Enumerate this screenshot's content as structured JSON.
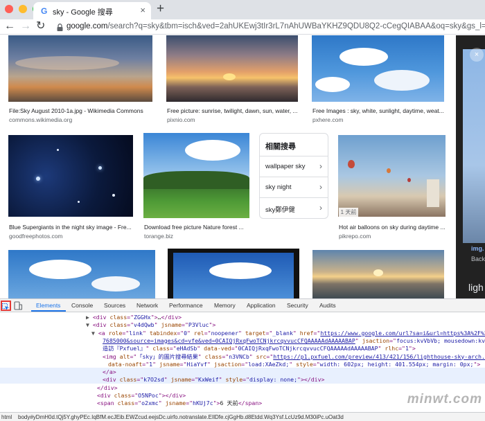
{
  "browser": {
    "tab_title": "sky - Google 搜尋",
    "tab_favicon": "G",
    "close_glyph": "×",
    "newtab_glyph": "+",
    "back_glyph": "←",
    "forward_glyph": "→",
    "reload_glyph": "↻",
    "url_host": "google.com",
    "url_path": "/search?q=sky&tbm=isch&ved=2ahUKEwj3tIr3rL7nAhUWBaYKHZ9QDU8Q2-cCegQIABAA&oq=sky&gs_l=img.3..0l10.3..."
  },
  "results": {
    "row1": [
      {
        "caption": "File:Sky August 2010-1a.jpg - Wikimedia Commons",
        "source": "commons.wikimedia.org"
      },
      {
        "caption": "Free picture: sunrise, twilight, dawn, sun, water, ...",
        "source": "pixnio.com"
      },
      {
        "caption": "Free Images : sky, white, sunlight, daytime, weat...",
        "source": "pxhere.com"
      }
    ],
    "row2": [
      {
        "caption": "Blue Supergiants in the night sky image - Fre...",
        "source": "goodfreephotos.com"
      },
      {
        "caption": "Download free picture Nature forest ...",
        "source": "torange.biz"
      },
      {
        "caption": "Hot air balloons on sky during daytime ...",
        "source": "pikrepo.com",
        "badge": "1 天前"
      }
    ]
  },
  "related": {
    "title": "相關搜尋",
    "chevron": "›",
    "items": [
      "wallpaper sky",
      "sky night",
      "sky鄭伊健"
    ]
  },
  "side_panel": {
    "close_glyph": "×",
    "snippet1": "img.",
    "snippet2": "Back",
    "snippet3": "ligh"
  },
  "devtools": {
    "tabs": [
      "Elements",
      "Console",
      "Sources",
      "Network",
      "Performance",
      "Memory",
      "Application",
      "Security",
      "Audits"
    ],
    "active_tab": "Elements",
    "breadcrumb_html": "html",
    "breadcrumb_body": "body#yDmH0d.tQj5Y.ghyPEc.IqBfM.ecJEib.EWZcud.eejsDc.uirfo.notranslate.EIlDfe.cjGgHb.d8Etdd.Wq3Ysf.LcUz9d.M30iPc.uOat3d",
    "code_lines": [
      {
        "indent": 16,
        "tri": "▶",
        "parts": [
          [
            "tag",
            "<div "
          ],
          [
            "attr",
            "class"
          ],
          [
            "tag",
            "=\""
          ],
          [
            "val",
            "ZGGHx"
          ],
          [
            "tag",
            "\">"
          ],
          [
            "txt",
            "…"
          ],
          [
            "tag",
            "</div>"
          ]
        ]
      },
      {
        "indent": 16,
        "tri": "▼",
        "parts": [
          [
            "tag",
            "<div "
          ],
          [
            "attr",
            "class"
          ],
          [
            "tag",
            "=\""
          ],
          [
            "val",
            "v4dQwb"
          ],
          [
            "tag",
            "\" "
          ],
          [
            "attr",
            "jsname"
          ],
          [
            "tag",
            "=\""
          ],
          [
            "val",
            "P3Vluc"
          ],
          [
            "tag",
            "\">"
          ]
        ]
      },
      {
        "indent": 24,
        "tri": "▼",
        "parts": [
          [
            "tag",
            "<a "
          ],
          [
            "attr",
            "role"
          ],
          [
            "tag",
            "=\""
          ],
          [
            "val",
            "link"
          ],
          [
            "tag",
            "\" "
          ],
          [
            "attr",
            "tabindex"
          ],
          [
            "tag",
            "=\""
          ],
          [
            "val",
            "0"
          ],
          [
            "tag",
            "\" "
          ],
          [
            "attr",
            "rel"
          ],
          [
            "tag",
            "=\""
          ],
          [
            "val",
            "noopener"
          ],
          [
            "tag",
            "\" "
          ],
          [
            "attr",
            "target"
          ],
          [
            "tag",
            "=\""
          ],
          [
            "val",
            "_blank"
          ],
          [
            "tag",
            "\" "
          ],
          [
            "attr",
            "href"
          ],
          [
            "tag",
            "=\""
          ],
          [
            "link",
            "https://www.google.com/url?sa=i&url=https%3A%2F%2F..."
          ]
        ]
      },
      {
        "indent": 40,
        "tri": "",
        "parts": [
          [
            "link",
            "7685000&source=images&cd=vfe&ved=0CAIQjRxqFwoTCNjkrcqvvucCFQAAAAAdAAAAABAP"
          ],
          [
            "tag",
            "\" "
          ],
          [
            "attr",
            "jsaction"
          ],
          [
            "tag",
            "=\""
          ],
          [
            "val",
            "focus:kvVbVb; mousedown:kvVbVb"
          ]
        ]
      },
      {
        "indent": 40,
        "tri": "",
        "parts": [
          [
            "val",
            "造訪『Pxfuel』"
          ],
          [
            "tag",
            "\" "
          ],
          [
            "attr",
            "class"
          ],
          [
            "tag",
            "=\""
          ],
          [
            "val",
            "eHAdSb"
          ],
          [
            "tag",
            "\" "
          ],
          [
            "attr",
            "data-ved"
          ],
          [
            "tag",
            "=\""
          ],
          [
            "val",
            "0CAIQjRxqFwoTCNjkrcqvvucCFQAAAAAdAAAAABAP"
          ],
          [
            "tag",
            "\" "
          ],
          [
            "attr",
            "rlhc"
          ],
          [
            "tag",
            "=\""
          ],
          [
            "val",
            "1"
          ],
          [
            "tag",
            "\">"
          ]
        ]
      },
      {
        "indent": 40,
        "tri": "",
        "parts": [
          [
            "tag",
            "<img "
          ],
          [
            "attr",
            "alt"
          ],
          [
            "tag",
            "=\""
          ],
          [
            "val",
            "「sky」的圖片搜尋結果"
          ],
          [
            "tag",
            "\" "
          ],
          [
            "attr",
            "class"
          ],
          [
            "tag",
            "=\""
          ],
          [
            "val",
            "n3VNCb"
          ],
          [
            "tag",
            "\" "
          ],
          [
            "attr",
            "src"
          ],
          [
            "tag",
            "=\""
          ],
          [
            "link",
            "https://p1.pxfuel.com/preview/413/421/156/lighthouse-sky-arch..."
          ]
        ]
      },
      {
        "indent": 48,
        "tri": "",
        "parts": [
          [
            "attr",
            "data-noaft"
          ],
          [
            "tag",
            "=\""
          ],
          [
            "val",
            "1"
          ],
          [
            "tag",
            "\" "
          ],
          [
            "attr",
            "jsname"
          ],
          [
            "tag",
            "=\""
          ],
          [
            "val",
            "HiaYvf"
          ],
          [
            "tag",
            "\" "
          ],
          [
            "attr",
            "jsaction"
          ],
          [
            "tag",
            "=\""
          ],
          [
            "val",
            "load:XAeZkd;"
          ],
          [
            "tag",
            "\" "
          ],
          [
            "attr",
            "style"
          ],
          [
            "tag",
            "=\""
          ],
          [
            "val",
            "width: 602px; height: 401.554px; margin: 0px;"
          ],
          [
            "tag",
            "\">"
          ]
        ]
      },
      {
        "indent": 40,
        "tri": "",
        "parts": [
          [
            "tag",
            "</a>"
          ]
        ]
      },
      {
        "indent": 40,
        "tri": "",
        "parts": [
          [
            "tag",
            "<div "
          ],
          [
            "attr",
            "class"
          ],
          [
            "tag",
            "=\""
          ],
          [
            "val",
            "k7O2sd"
          ],
          [
            "tag",
            "\" "
          ],
          [
            "attr",
            "jsname"
          ],
          [
            "tag",
            "=\""
          ],
          [
            "val",
            "KxWeif"
          ],
          [
            "tag",
            "\" "
          ],
          [
            "attr",
            "style"
          ],
          [
            "tag",
            "=\""
          ],
          [
            "val",
            "display: none;"
          ],
          [
            "tag",
            "\"></div>"
          ]
        ]
      },
      {
        "indent": 32,
        "tri": "",
        "parts": [
          [
            "tag",
            "</div>"
          ]
        ]
      },
      {
        "indent": 32,
        "tri": "",
        "parts": [
          [
            "tag",
            "<div "
          ],
          [
            "attr",
            "class"
          ],
          [
            "tag",
            "=\""
          ],
          [
            "val",
            "O5NPoc"
          ],
          [
            "tag",
            "\"></div>"
          ]
        ]
      },
      {
        "indent": 32,
        "tri": "",
        "parts": [
          [
            "tag",
            "<span "
          ],
          [
            "attr",
            "class"
          ],
          [
            "tag",
            "=\""
          ],
          [
            "val",
            "o2xmc"
          ],
          [
            "tag",
            "\" "
          ],
          [
            "attr",
            "jsname"
          ],
          [
            "tag",
            "=\""
          ],
          [
            "val",
            "hKUj7c"
          ],
          [
            "tag",
            "\">"
          ],
          [
            "txt",
            "6 天前"
          ],
          [
            "tag",
            "</span>"
          ]
        ]
      }
    ]
  },
  "watermark": "minwt.com"
}
